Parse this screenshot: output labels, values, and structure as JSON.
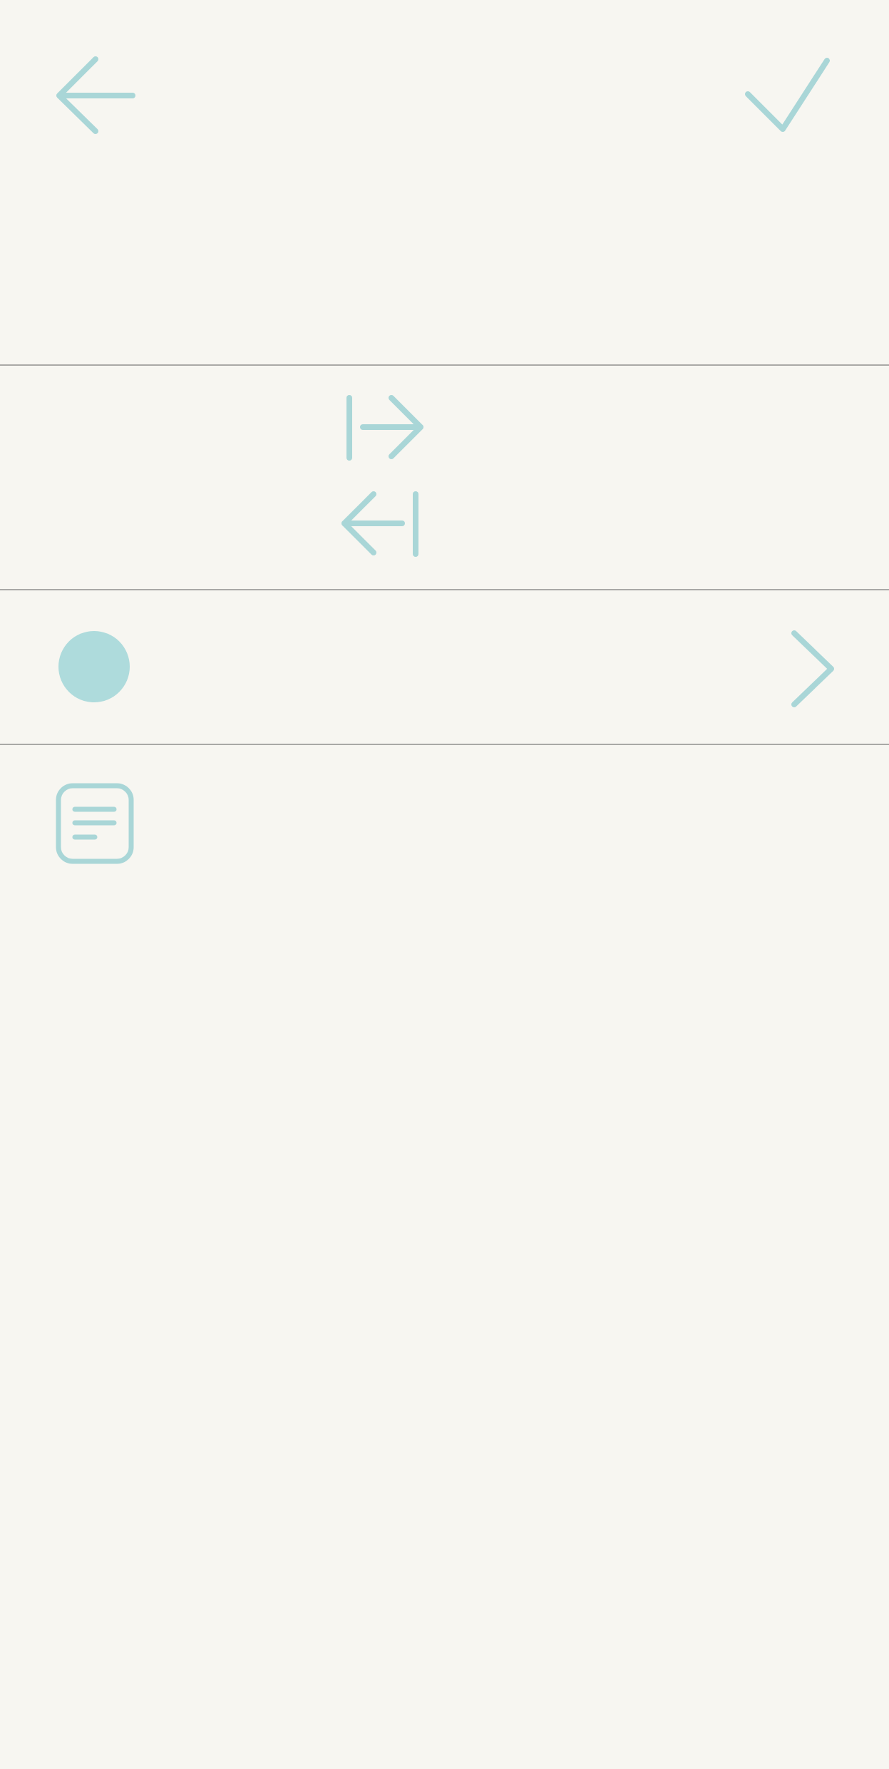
{
  "colors": {
    "background": "#F7F6F1",
    "accent": "#A9D6D7",
    "divider": "#A9A9A6"
  },
  "header": {
    "back_icon": "arrow-left-icon",
    "confirm_icon": "checkmark-icon"
  },
  "indent_controls": {
    "indent_icon": "indent-right-icon",
    "outdent_icon": "outdent-left-icon"
  },
  "color_row": {
    "swatch_color": "#AEDBDC",
    "chevron_icon": "chevron-right-icon"
  },
  "note_row": {
    "icon": "note-lines-icon"
  }
}
